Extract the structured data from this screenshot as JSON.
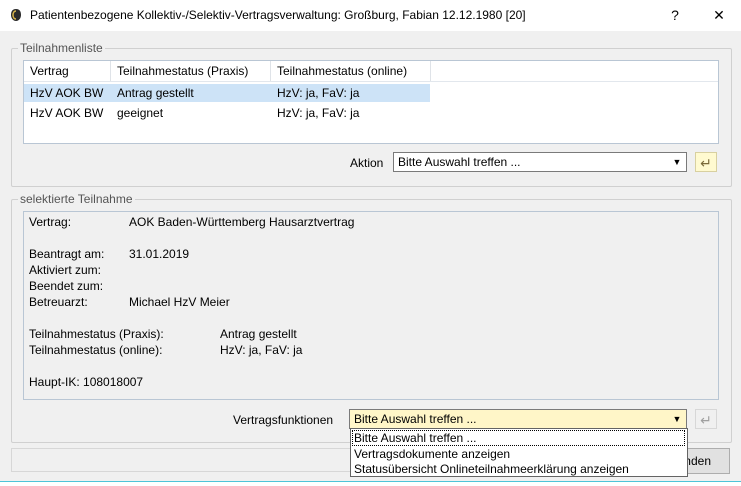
{
  "window": {
    "title": "Patientenbezogene Kollektiv-/Selektiv-Vertragsverwaltung: Großburg, Fabian 12.12.1980  [20]",
    "help_label": "?",
    "close_label": "✕",
    "icon": "app-logo-icon"
  },
  "participations": {
    "legend": "Teilnahmenliste",
    "columns": [
      "Vertrag",
      "Teilnahmestatus (Praxis)",
      "Teilnahmestatus (online)"
    ],
    "rows": [
      {
        "contract": "HzV AOK BW",
        "status_practice": "Antrag gestellt",
        "status_online": "HzV: ja, FaV: ja",
        "selected": true
      },
      {
        "contract": "HzV AOK BW",
        "status_practice": "geeignet",
        "status_online": "HzV: ja, FaV: ja",
        "selected": false
      }
    ],
    "action_label": "Aktion",
    "action_value": "Bitte Auswahl treffen ...",
    "enter_icon": "enter-arrow-icon"
  },
  "selected": {
    "legend": "selektierte Teilnahme",
    "contract_label": "Vertrag:",
    "contract_value": "AOK Baden-Württemberg Hausarztvertrag",
    "requested_label": "Beantragt am:",
    "requested_value": "31.01.2019",
    "activated_label": "Aktiviert zum:",
    "ended_label": "Beendet zum:",
    "doctor_label": "Betreuarzt:",
    "doctor_value": "Michael HzV Meier",
    "status_practice_label": "Teilnahmestatus (Praxis):",
    "status_practice_value": "Antrag gestellt",
    "status_online_label": "Teilnahmestatus (online):",
    "status_online_value": "HzV: ja, FaV: ja",
    "main_ik": "Haupt-IK: 108018007",
    "functions_label": "Vertragsfunktionen",
    "functions_value": "Bitte Auswahl treffen ...",
    "functions_options": [
      "Bitte Auswahl treffen ...",
      "Vertragsdokumente anzeigen",
      "Statusübersicht Onlineteilnahmeerklärung anzeigen"
    ]
  },
  "footer": {
    "button_visible_text": "nden"
  },
  "colors": {
    "selection": "#cde3f7",
    "combo_highlight": "#fff6c8",
    "enter_button": "#fffad0"
  }
}
